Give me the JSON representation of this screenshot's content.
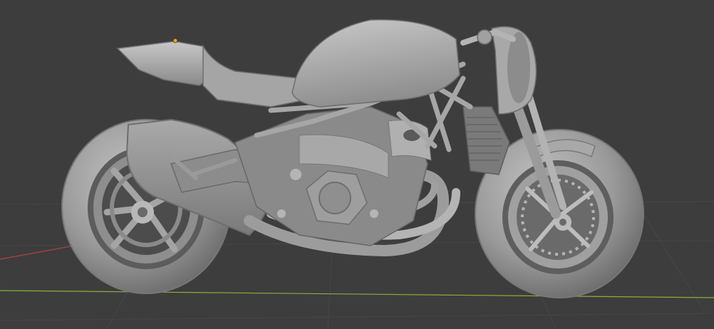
{
  "viewport": {
    "background": "#3d3d3d",
    "grid_color": "#4a4a4a",
    "axis_x_color": "#b0434a",
    "axis_y_color": "#8cae3a"
  },
  "model": {
    "name": "motorcycle",
    "shading": "solid",
    "base_color": "#9c9c9c",
    "dark_color": "#6f6f6f",
    "light_color": "#c4c4c4"
  },
  "origin_marker": {
    "color": "#f3a21f",
    "icon": "object-origin-dot"
  }
}
